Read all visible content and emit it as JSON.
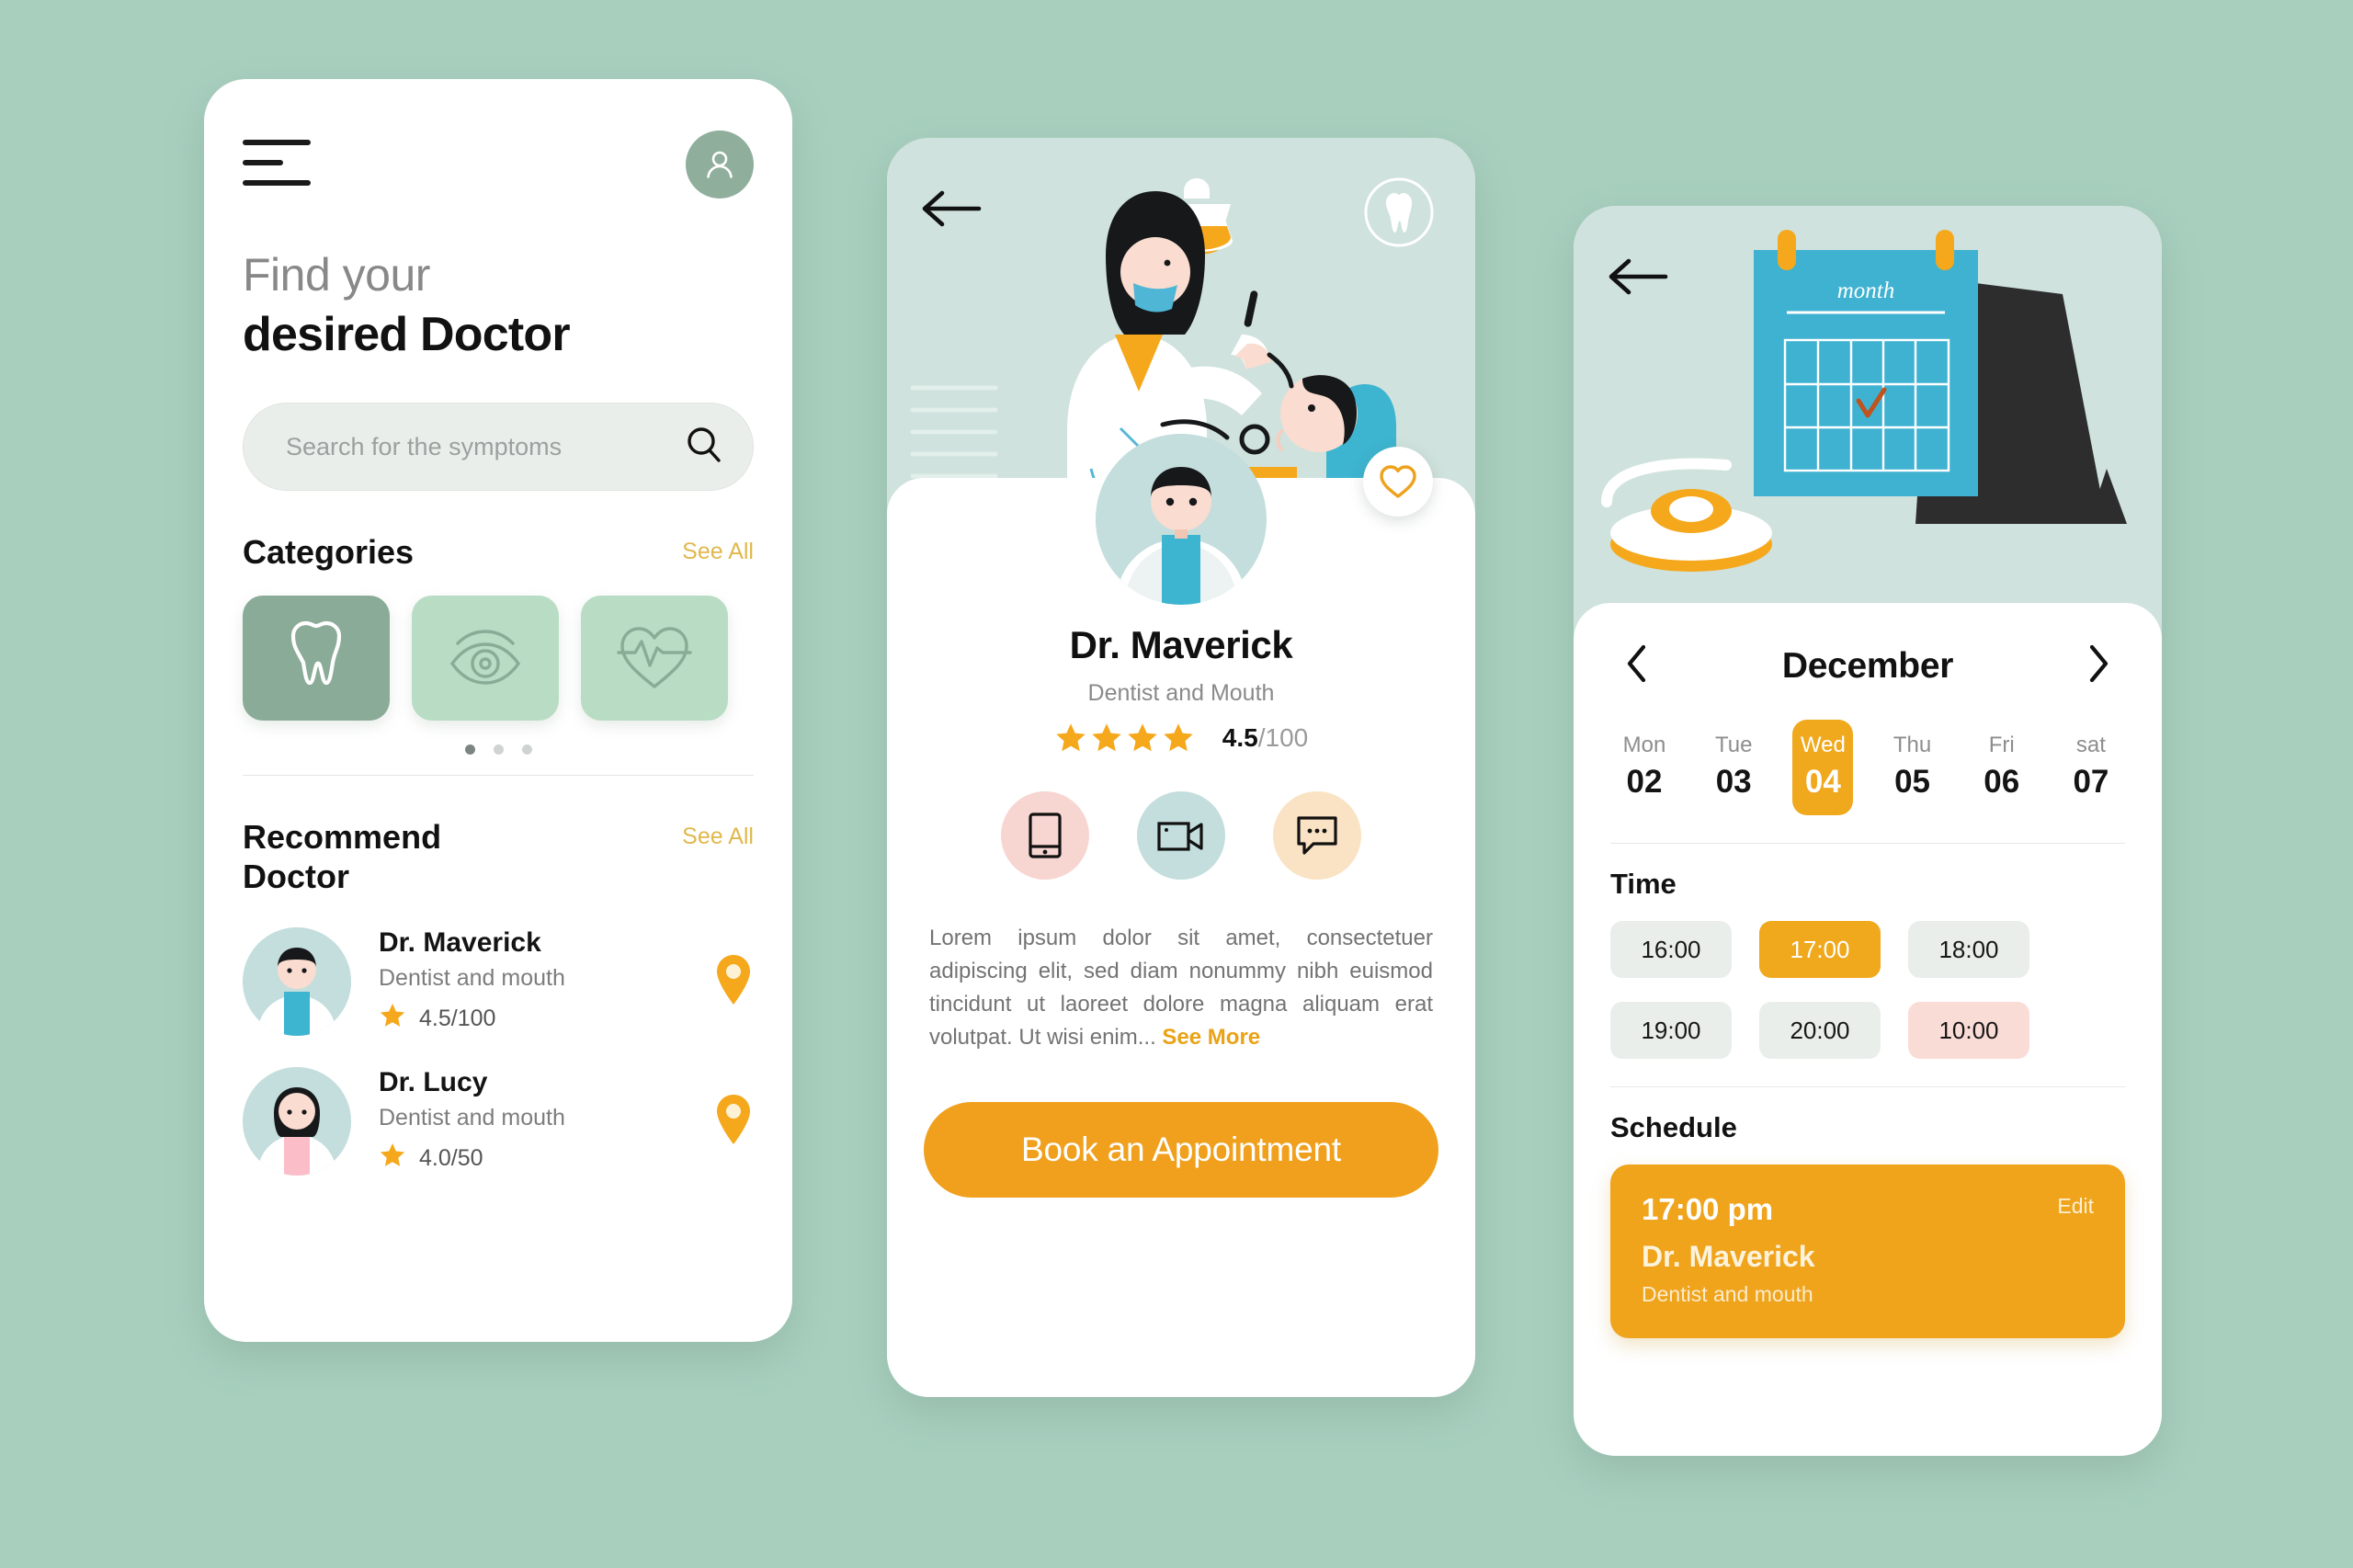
{
  "screen1": {
    "name": "find-doctor-home",
    "icons": {
      "menu": "hamburger-icon",
      "avatar": "user-avatar-icon",
      "search": "search-icon"
    },
    "title_light": "Find your",
    "title_bold": "desired Doctor",
    "search": {
      "placeholder": "Search for the symptoms",
      "value": ""
    },
    "categories": {
      "title": "Categories",
      "see_all": "See All",
      "items": [
        {
          "icon": "tooth-icon",
          "active": true
        },
        {
          "icon": "eye-icon",
          "active": false
        },
        {
          "icon": "heartbeat-icon",
          "active": false
        }
      ],
      "dots": 3,
      "active_dot": 0
    },
    "recommend": {
      "title": "Recommend Doctor",
      "title_line1": "Recommend",
      "title_line2": "Doctor",
      "see_all": "See All",
      "doctors": [
        {
          "name": "Dr. Maverick",
          "specialty": "Dentist and mouth",
          "rating": "4.5/100",
          "avatar": "male-doctor-avatar",
          "action_icon": "location-pin-icon"
        },
        {
          "name": "Dr. Lucy",
          "specialty": "Dentist and mouth",
          "rating": "4.0/50",
          "avatar": "female-doctor-avatar",
          "action_icon": "location-pin-icon"
        }
      ]
    }
  },
  "screen2": {
    "name": "doctor-detail",
    "back_icon": "back-arrow-icon",
    "badge_icon": "tooth-badge-icon",
    "favorite_icon": "heart-outline-icon",
    "hero_illustration": "dentist-treating-patient-illustration",
    "doctor": {
      "name": "Dr. Maverick",
      "specialty": "Dentist and Mouth",
      "stars_filled": 4,
      "rating_value": "4.5",
      "rating_sep": "/",
      "rating_max": "100"
    },
    "actions": [
      {
        "icon": "phone-icon",
        "color": "#f7d6d2"
      },
      {
        "icon": "video-camera-icon",
        "color": "#c4dedd"
      },
      {
        "icon": "chat-bubble-icon",
        "color": "#fae3c4"
      }
    ],
    "description": "Lorem ipsum dolor sit amet, consectetuer adipiscing elit, sed diam nonummy nibh euismod tincidunt ut laoreet dolore magna aliquam erat volutpat. Ut wisi enim...",
    "see_more": "See More",
    "book_button": "Book an Appointment"
  },
  "screen3": {
    "name": "appointment-booking",
    "back_icon": "back-arrow-icon",
    "hero_illustration": "calendar-and-stethoscope-illustration",
    "calendar_label": "month",
    "prev_icon": "chevron-left-icon",
    "next_icon": "chevron-right-icon",
    "month": "December",
    "days": [
      {
        "label": "Mon",
        "num": "02",
        "selected": false
      },
      {
        "label": "Tue",
        "num": "03",
        "selected": false
      },
      {
        "label": "Wed",
        "num": "04",
        "selected": true
      },
      {
        "label": "Thu",
        "num": "05",
        "selected": false
      },
      {
        "label": "Fri",
        "num": "06",
        "selected": false
      },
      {
        "label": "sat",
        "num": "07",
        "selected": false
      }
    ],
    "time": {
      "title": "Time",
      "slots": [
        {
          "label": "16:00",
          "state": "free"
        },
        {
          "label": "17:00",
          "state": "selected"
        },
        {
          "label": "18:00",
          "state": "free"
        },
        {
          "label": "19:00",
          "state": "free"
        },
        {
          "label": "20:00",
          "state": "free"
        },
        {
          "label": "10:00",
          "state": "busy"
        }
      ]
    },
    "schedule": {
      "title": "Schedule",
      "time": "17:00 pm",
      "doctor": "Dr. Maverick",
      "specialty": "Dentist and mouth",
      "edit": "Edit"
    }
  },
  "theme": {
    "background": "#a8cfbe",
    "accent_orange": "#f0a01c",
    "accent_gold": "#e0b84c",
    "mint_dark": "#8aab97",
    "mint_light": "#b9dcc4",
    "hero_bg": "#cfe2dd"
  }
}
